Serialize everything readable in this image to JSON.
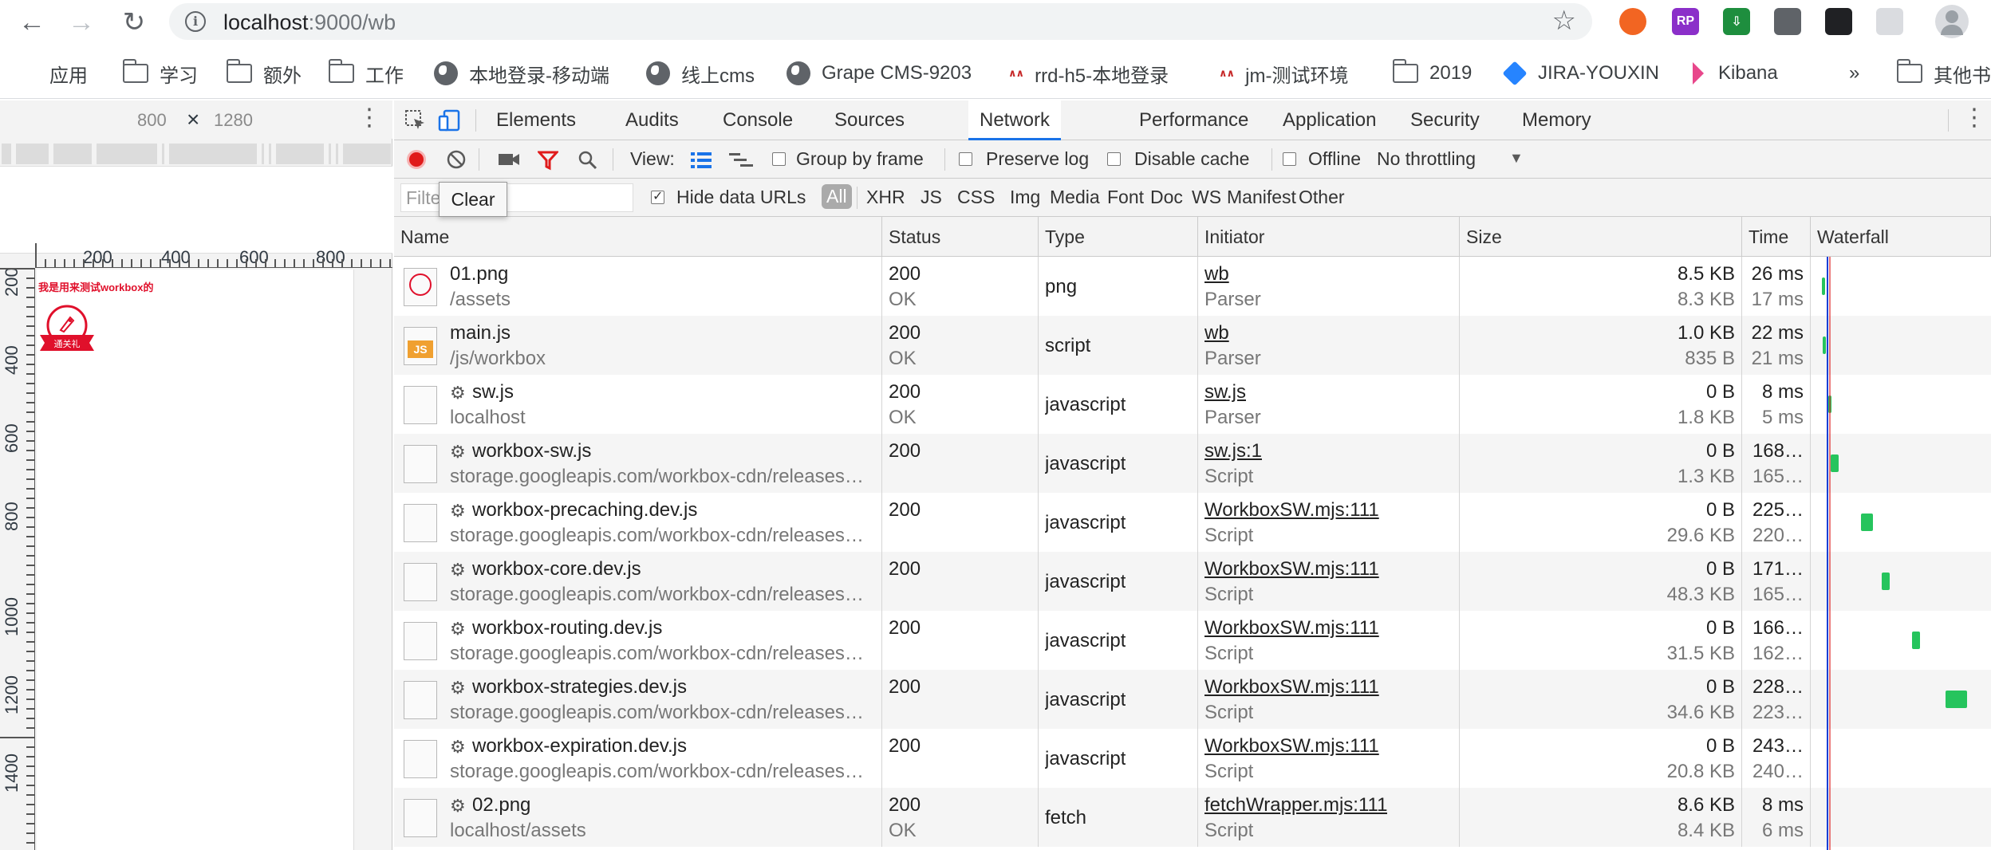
{
  "browser": {
    "url_host": "localhost",
    "url_rest": ":9000/wb",
    "extensions": [
      {
        "name": "ext-orange-ring-icon",
        "label": "",
        "color": "#f26522"
      },
      {
        "name": "ext-rp-icon",
        "label": "RP",
        "color": "#8b2fc9"
      },
      {
        "name": "ext-download-icon",
        "label": "⇩",
        "color": "#1e8e3e"
      },
      {
        "name": "ext-pocket-icon",
        "label": "",
        "color": "#5f6368"
      },
      {
        "name": "ext-qr-icon",
        "label": "",
        "color": "#202124"
      },
      {
        "name": "ext-settings-icon",
        "label": "",
        "color": "#dadce0"
      }
    ]
  },
  "bookmarks": [
    {
      "label": "应用",
      "icon": "apps-grid-icon"
    },
    {
      "label": "学习",
      "icon": "folder-icon"
    },
    {
      "label": "额外",
      "icon": "folder-icon"
    },
    {
      "label": "工作",
      "icon": "folder-icon"
    },
    {
      "label": "本地登录-移动端",
      "icon": "globe-icon"
    },
    {
      "label": "线上cms",
      "icon": "globe-icon"
    },
    {
      "label": "Grape CMS-9203",
      "icon": "globe-icon"
    },
    {
      "label": "rrd-h5-本地登录",
      "icon": "rrd-icon"
    },
    {
      "label": "jm-测试环境",
      "icon": "rrd-icon"
    },
    {
      "label": "2019",
      "icon": "folder-icon"
    },
    {
      "label": "JIRA-YOUXIN",
      "icon": "jira-icon"
    },
    {
      "label": "Kibana",
      "icon": "kibana-icon"
    },
    {
      "label": "»",
      "icon": ""
    },
    {
      "label": "其他书",
      "icon": "folder-icon"
    }
  ],
  "device": {
    "width": "800",
    "x": "×",
    "height": "1280",
    "ruler_top": [
      "200",
      "400",
      "600",
      "800"
    ],
    "ruler_left": [
      "200",
      "400",
      "600",
      "800",
      "1000",
      "1200",
      "1400"
    ],
    "page_heading": "我是用来测试workbox的",
    "badge_text": "通关礼"
  },
  "devtools": {
    "tabs": [
      "Elements",
      "Audits",
      "Console",
      "Sources",
      "Network",
      "Performance",
      "Application",
      "Security",
      "Memory"
    ],
    "active_tab": "Network",
    "toolbar": {
      "view_label": "View:",
      "group_by_frame": "Group by frame",
      "preserve_log": "Preserve log",
      "disable_cache": "Disable cache",
      "offline": "Offline",
      "throttling": "No throttling"
    },
    "filter": {
      "placeholder": "Filter",
      "hide_data_urls": "Hide data URLs",
      "types": [
        "All",
        "XHR",
        "JS",
        "CSS",
        "Img",
        "Media",
        "Font",
        "Doc",
        "WS",
        "Manifest",
        "Other"
      ]
    },
    "tooltip": "Clear",
    "columns": [
      "Name",
      "Status",
      "Type",
      "Initiator",
      "Size",
      "Time",
      "Waterfall"
    ],
    "rows": [
      {
        "name": "01.png",
        "path": "/assets",
        "status": "200",
        "status_text": "OK",
        "type": "png",
        "initiator": "wb",
        "initiator_sub": "Parser",
        "size": "8.5 KB",
        "size_sub": "8.3 KB",
        "time": "26 ms",
        "time_sub": "17 ms",
        "icon": "png-file-icon",
        "sw": false,
        "wf_start": 0.0,
        "wf_width": 0.005
      },
      {
        "name": "main.js",
        "path": "/js/workbox",
        "status": "200",
        "status_text": "OK",
        "type": "script",
        "initiator": "wb",
        "initiator_sub": "Parser",
        "size": "1.0 KB",
        "size_sub": "835 B",
        "time": "22 ms",
        "time_sub": "21 ms",
        "icon": "js-file-icon",
        "sw": false,
        "wf_start": 0.004,
        "wf_width": 0.004
      },
      {
        "name": "sw.js",
        "path": "localhost",
        "status": "200",
        "status_text": "OK",
        "type": "javascript",
        "initiator": "sw.js",
        "initiator_sub": "Parser",
        "size": "0 B",
        "size_sub": "1.8 KB",
        "time": "8 ms",
        "time_sub": "5 ms",
        "icon": "blank-file-icon",
        "sw": true,
        "wf_start": 0.045,
        "wf_width": 0.003
      },
      {
        "name": "workbox-sw.js",
        "path": "storage.googleapis.com/workbox-cdn/releases…",
        "status": "200",
        "status_text": "",
        "type": "javascript",
        "initiator": "sw.js:1",
        "initiator_sub": "Script",
        "size": "0 B",
        "size_sub": "1.3 KB",
        "time": "168…",
        "time_sub": "165…",
        "icon": "blank-file-icon",
        "sw": true,
        "wf_start": 0.058,
        "wf_width": 0.06
      },
      {
        "name": "workbox-precaching.dev.js",
        "path": "storage.googleapis.com/workbox-cdn/releases…",
        "status": "200",
        "status_text": "",
        "type": "javascript",
        "initiator": "WorkboxSW.mjs:111",
        "initiator_sub": "Script",
        "size": "0 B",
        "size_sub": "29.6 KB",
        "time": "225…",
        "time_sub": "220…",
        "icon": "blank-file-icon",
        "sw": true,
        "wf_start": 0.27,
        "wf_width": 0.08
      },
      {
        "name": "workbox-core.dev.js",
        "path": "storage.googleapis.com/workbox-cdn/releases…",
        "status": "200",
        "status_text": "",
        "type": "javascript",
        "initiator": "WorkboxSW.mjs:111",
        "initiator_sub": "Script",
        "size": "0 B",
        "size_sub": "48.3 KB",
        "time": "171…",
        "time_sub": "165…",
        "icon": "blank-file-icon",
        "sw": true,
        "wf_start": 0.41,
        "wf_width": 0.055
      },
      {
        "name": "workbox-routing.dev.js",
        "path": "storage.googleapis.com/workbox-cdn/releases…",
        "status": "200",
        "status_text": "",
        "type": "javascript",
        "initiator": "WorkboxSW.mjs:111",
        "initiator_sub": "Script",
        "size": "0 B",
        "size_sub": "31.5 KB",
        "time": "166…",
        "time_sub": "162…",
        "icon": "blank-file-icon",
        "sw": true,
        "wf_start": 0.62,
        "wf_width": 0.055
      },
      {
        "name": "workbox-strategies.dev.js",
        "path": "storage.googleapis.com/workbox-cdn/releases…",
        "status": "200",
        "status_text": "",
        "type": "javascript",
        "initiator": "WorkboxSW.mjs:111",
        "initiator_sub": "Script",
        "size": "0 B",
        "size_sub": "34.6 KB",
        "time": "228…",
        "time_sub": "223…",
        "icon": "blank-file-icon",
        "sw": true,
        "wf_start": 0.85,
        "wf_width": 0.15
      },
      {
        "name": "workbox-expiration.dev.js",
        "path": "storage.googleapis.com/workbox-cdn/releases…",
        "status": "200",
        "status_text": "",
        "type": "javascript",
        "initiator": "WorkboxSW.mjs:111",
        "initiator_sub": "Script",
        "size": "0 B",
        "size_sub": "20.8 KB",
        "time": "243…",
        "time_sub": "240…",
        "icon": "blank-file-icon",
        "sw": true,
        "wf_start": 1.0,
        "wf_width": 0.0
      },
      {
        "name": "02.png",
        "path": "localhost/assets",
        "status": "200",
        "status_text": "OK",
        "type": "fetch",
        "initiator": "fetchWrapper.mjs:111",
        "initiator_sub": "Script",
        "size": "8.6 KB",
        "size_sub": "8.4 KB",
        "time": "8 ms",
        "time_sub": "6 ms",
        "icon": "blank-file-icon",
        "sw": true,
        "wf_start": 1.0,
        "wf_width": 0.0
      }
    ]
  }
}
